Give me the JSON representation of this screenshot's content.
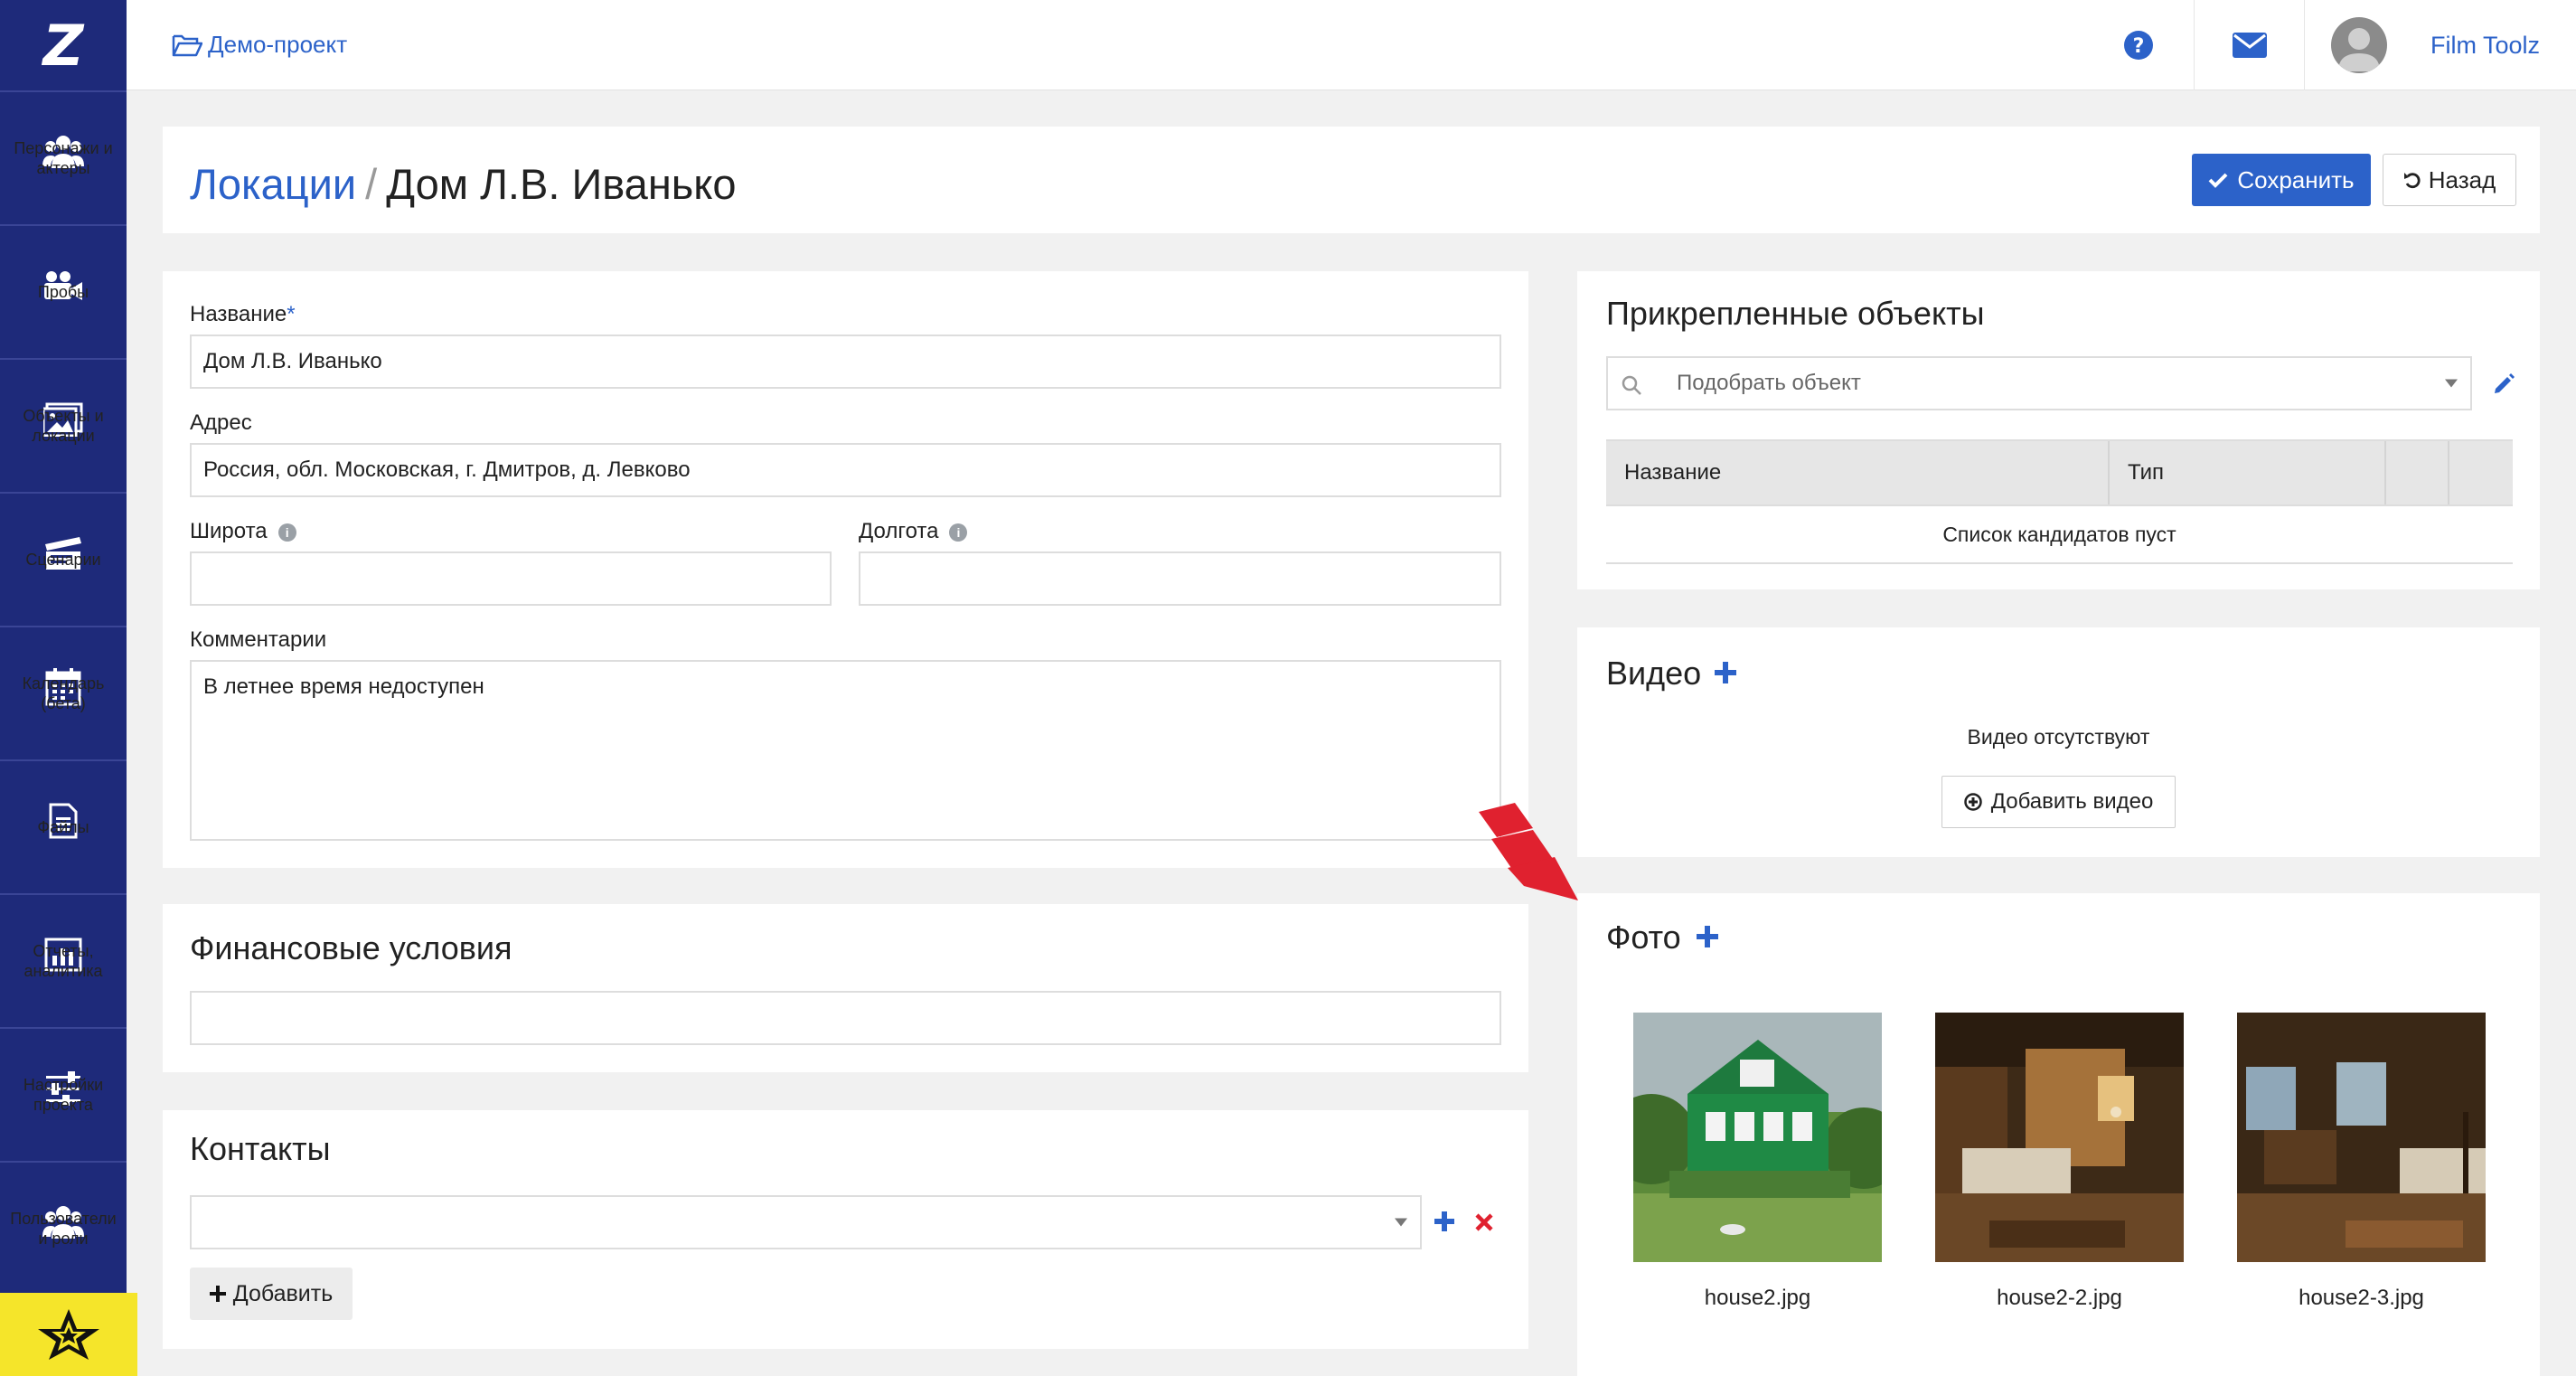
{
  "sidebar": {
    "logo": "Z",
    "items": [
      {
        "label": "Персонажи и актеры",
        "icon": "users-icon"
      },
      {
        "label": "Пробы",
        "icon": "video-camera-icon"
      },
      {
        "label": "Объекты и локации",
        "icon": "image-icon"
      },
      {
        "label": "Сценарии",
        "icon": "clapperboard-icon"
      },
      {
        "label": "Календарь (бета)",
        "icon": "calendar-icon"
      },
      {
        "label": "Файлы",
        "icon": "file-icon"
      },
      {
        "label": "Отчеты, аналитика",
        "icon": "bar-chart-icon"
      },
      {
        "label": "Настройки проекта",
        "icon": "sliders-icon"
      },
      {
        "label": "Пользователи и роли",
        "icon": "users-icon"
      }
    ]
  },
  "topbar": {
    "project": "Демо-проект",
    "user_name": "Film Toolz"
  },
  "header": {
    "breadcrumb": "Локации",
    "separator": "/",
    "title": "Дом Л.В. Иванько",
    "save_label": "Сохранить",
    "back_label": "Назад"
  },
  "form": {
    "name_label": "Название",
    "name_required_mark": "*",
    "name_value": "Дом Л.В. Иванько",
    "address_label": "Адрес",
    "address_value": "Россия, обл. Московская, г. Дмитров, д. Левково",
    "lat_label": "Широта",
    "lat_value": "",
    "lon_label": "Долгота",
    "lon_value": "",
    "comments_label": "Комментарии",
    "comments_value": "В летнее время недоступен"
  },
  "finance": {
    "title": "Финансовые условия",
    "value": ""
  },
  "contacts": {
    "title": "Контакты",
    "selected": "",
    "add_label": "Добавить"
  },
  "attached": {
    "title": "Прикрепленные объекты",
    "search_placeholder": "Подобрать объект",
    "columns": [
      "Название",
      "Тип",
      "",
      ""
    ],
    "empty_text": "Список кандидатов пуст"
  },
  "video": {
    "title": "Видео",
    "empty_text": "Видео отсутствуют",
    "add_label": "Добавить видео"
  },
  "photo": {
    "title": "Фото",
    "items": [
      {
        "name": "house2.jpg"
      },
      {
        "name": "house2-2.jpg"
      },
      {
        "name": "house2-3.jpg"
      }
    ]
  },
  "colors": {
    "sidebar": "#1e2a7a",
    "accent": "#2c62c9",
    "delete": "#e0212f",
    "star_bg": "#f5e52a"
  }
}
